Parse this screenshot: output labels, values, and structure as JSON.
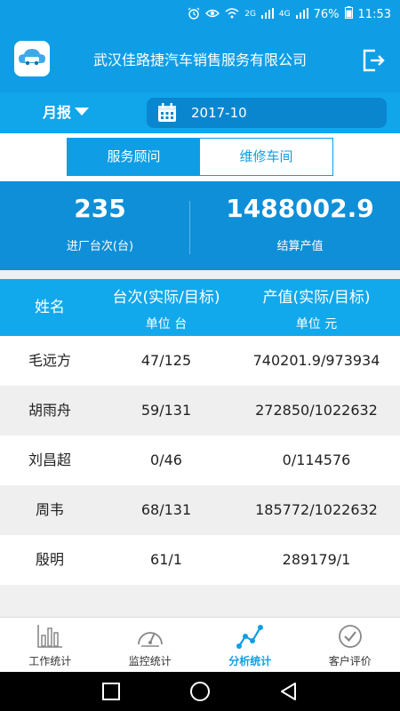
{
  "status_bar": {
    "icons": [
      "alarm-icon",
      "eye-icon",
      "wifi-icon",
      "signal-icon"
    ],
    "net1": "2G",
    "net2": "4G",
    "battery": "76%",
    "time": "11:53"
  },
  "app_bar": {
    "title": "武汉佳路捷汽车销售服务有限公司"
  },
  "filter": {
    "period_label": "月报",
    "date_value": "2017-10"
  },
  "tabs": [
    {
      "label": "服务顾问",
      "active": true
    },
    {
      "label": "维修车间",
      "active": false
    }
  ],
  "summary": {
    "entries": "235",
    "entries_label": "进厂台次(台)",
    "settlement": "1488002.9",
    "settlement_label": "结算产值"
  },
  "table": {
    "headers": {
      "name": "姓名",
      "count": "台次(实际/目标)",
      "count_unit": "单位 台",
      "value": "产值(实际/目标)",
      "value_unit": "单位 元"
    },
    "rows": [
      {
        "name": "毛远方",
        "count": "47/125",
        "value": "740201.9/973934"
      },
      {
        "name": "胡雨舟",
        "count": "59/131",
        "value": "272850/1022632"
      },
      {
        "name": "刘昌超",
        "count": "0/46",
        "value": "0/114576"
      },
      {
        "name": "周韦",
        "count": "68/131",
        "value": "185772/1022632"
      },
      {
        "name": "殷明",
        "count": "61/1",
        "value": "289179/1"
      }
    ]
  },
  "bottom_nav": [
    {
      "label": "工作统计",
      "icon": "bar-chart-icon",
      "active": false
    },
    {
      "label": "监控统计",
      "icon": "gauge-icon",
      "active": false
    },
    {
      "label": "分析统计",
      "icon": "trend-line-icon",
      "active": true
    },
    {
      "label": "客户评价",
      "icon": "check-circle-icon",
      "active": false
    }
  ],
  "colors": {
    "primary": "#0f9ee6",
    "header_row": "#12a8ec",
    "summary_bg": "#0f8fd8"
  }
}
